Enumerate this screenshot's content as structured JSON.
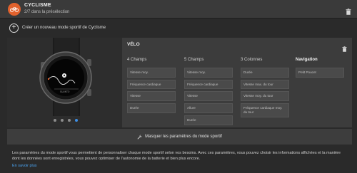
{
  "header": {
    "title": "CYCLISME",
    "subtitle": "2/7 dans la présélection",
    "icon": "bicycle-icon",
    "accent": "#e2622d"
  },
  "create": {
    "label": "Créer un nouveau mode sportif de Cyclisme"
  },
  "watch": {
    "brand": "SUUNTO",
    "carousel_pages": 4,
    "carousel_active": 4
  },
  "config": {
    "title": "VÉLO",
    "columns": [
      {
        "title": "4 Champs",
        "fields": [
          "Vitesse moy.",
          "Fréquence cardiaque",
          "Vitesse",
          "Durée"
        ]
      },
      {
        "title": "5 Champs",
        "fields": [
          "Vitesse moy.",
          "Fréquence cardiaque",
          "Vitesse",
          "Allure",
          "Durée"
        ]
      },
      {
        "title": "3 Colonnes",
        "fields": [
          "Durée",
          "Vitesse max. du tour",
          "Vitesse moy. du tour",
          "Fréquence cardiaque moy. du tour"
        ]
      },
      {
        "title": "Navigation",
        "fields": [
          "Petit Poucet"
        ]
      }
    ]
  },
  "toggle": {
    "label": "Masquer les paramètres du mode sportif"
  },
  "footer": {
    "description": "Les paramètres du mode sportif vous permettent de personnaliser chaque mode sportif selon vos besoins. Avec ces paramètres, vous pouvez choisir les informations affichées et la manière dont les données sont enregistrées, vous pouvez optimiser de l'autonomie de la batterie et bien plus encore.",
    "link": "En savoir plus",
    "link_color": "#4aa3f0"
  }
}
